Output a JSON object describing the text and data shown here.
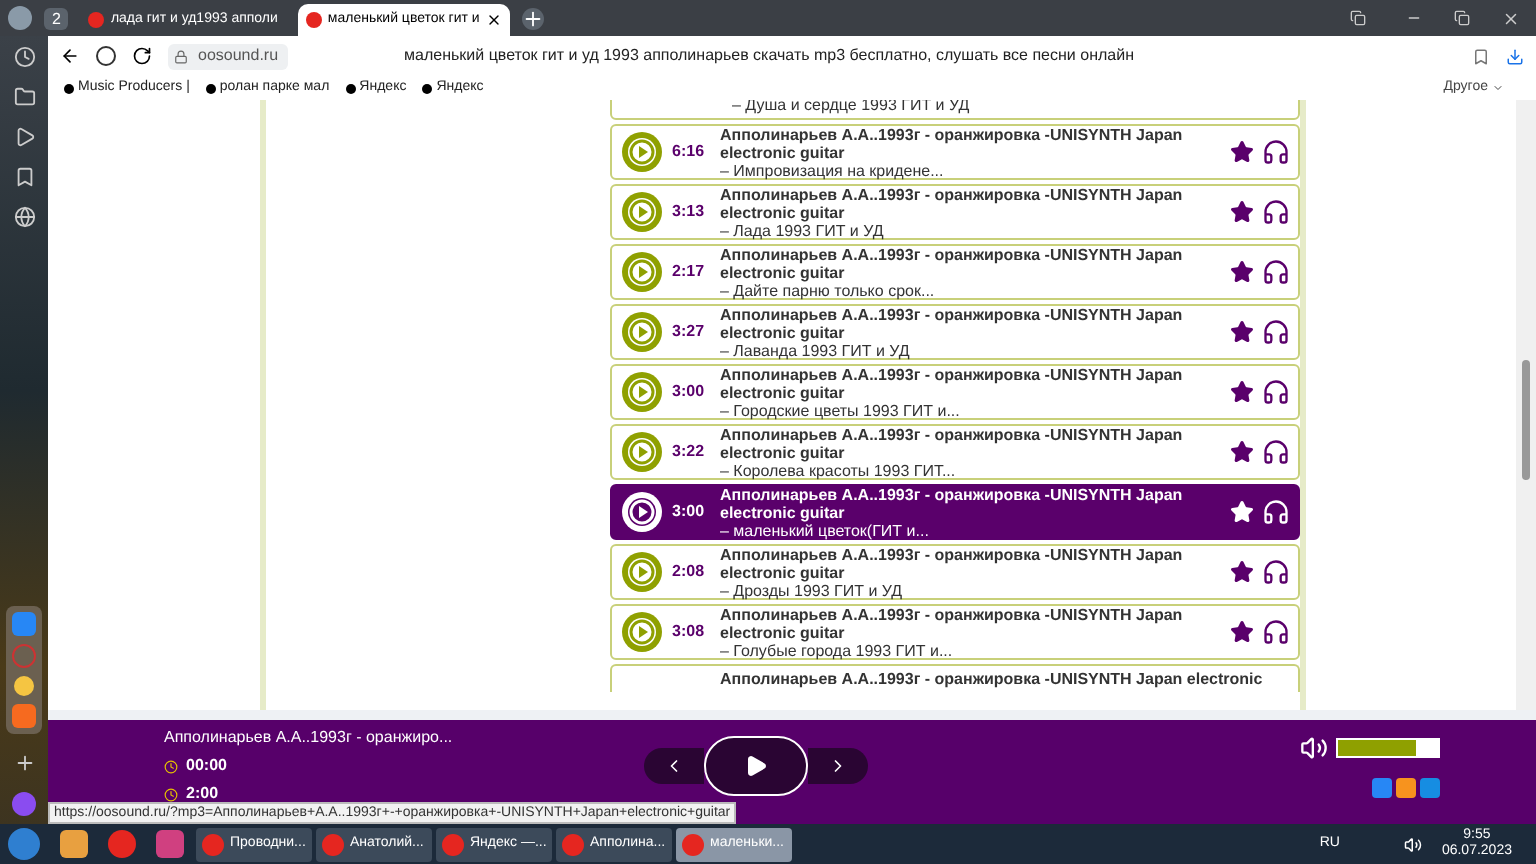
{
  "browser": {
    "tab_count": "2",
    "tabs": [
      {
        "title": "лада гит и уд1993 апполи",
        "selected": false
      },
      {
        "title": "маленький цветок гит и",
        "selected": true
      }
    ],
    "address": "oosound.ru",
    "page_title": "маленький цветок гит и уд 1993 апполинарьев скачать mp3 бесплатно, слушать все песни онлайн",
    "bookmarks": [
      "Music Producers |",
      "ролан парке мал",
      "Яндекс",
      "Яндекс"
    ],
    "other_bookmarks": "Другое"
  },
  "tracks": {
    "first_partial": "– Душа и сердце 1993 ГИТ и УД",
    "rows": [
      {
        "time": "6:16",
        "title": "Апполинарьев А.А..1993г - оранжировка -UNISYNTH Japan electronic guitar",
        "subtitle": "– Импровизация на кридене...",
        "selected": false
      },
      {
        "time": "3:13",
        "title": "Апполинарьев А.А..1993г - оранжировка -UNISYNTH Japan electronic guitar",
        "subtitle": "– Лада 1993 ГИТ и УД",
        "selected": false
      },
      {
        "time": "2:17",
        "title": "Апполинарьев А.А..1993г - оранжировка -UNISYNTH Japan electronic guitar",
        "subtitle": "– Дайте парню только срок...",
        "selected": false
      },
      {
        "time": "3:27",
        "title": "Апполинарьев А.А..1993г - оранжировка -UNISYNTH Japan electronic guitar",
        "subtitle": "– Лаванда 1993 ГИТ и УД",
        "selected": false
      },
      {
        "time": "3:00",
        "title": "Апполинарьев А.А..1993г - оранжировка -UNISYNTH Japan electronic guitar",
        "subtitle": "– Городские цветы 1993 ГИТ и...",
        "selected": false
      },
      {
        "time": "3:22",
        "title": "Апполинарьев А.А..1993г - оранжировка -UNISYNTH Japan electronic guitar",
        "subtitle": "– Королева красоты 1993 ГИТ...",
        "selected": false
      },
      {
        "time": "3:00",
        "title": "Апполинарьев А.А..1993г - оранжировка -UNISYNTH Japan electronic guitar",
        "subtitle": "– маленький цветок(ГИТ и...",
        "selected": true
      },
      {
        "time": "2:08",
        "title": "Апполинарьев А.А..1993г - оранжировка -UNISYNTH Japan electronic guitar",
        "subtitle": "– Дрозды 1993 ГИТ и УД",
        "selected": false
      },
      {
        "time": "3:08",
        "title": "Апполинарьев А.А..1993г - оранжировка -UNISYNTH Japan electronic guitar",
        "subtitle": "– Голубые города 1993 ГИТ и...",
        "selected": false
      }
    ],
    "last_partial": "Апполинарьев А.А..1993г - оранжировка -UNISYNTH Japan electronic"
  },
  "player": {
    "title": "Апполинарьев А.А..1993г - оранжиро...",
    "elapsed": "00:00",
    "duration": "2:00",
    "volume": {
      "level": 0.78
    }
  },
  "status_url": "https://oosound.ru/?mp3=Апполинарьев+А.А..1993г+-+оранжировка+-UNISYNTH+Japan+electronic+guitar",
  "taskbar": {
    "items": [
      {
        "label": "Проводни...",
        "selected": false
      },
      {
        "label": "Анатолий...",
        "selected": false
      },
      {
        "label": "Яндекс —...",
        "selected": false
      },
      {
        "label": "Апполина...",
        "selected": false
      },
      {
        "label": "маленьки...",
        "selected": true
      }
    ],
    "language": "RU",
    "time": "9:55",
    "date": "06.07.2023"
  }
}
